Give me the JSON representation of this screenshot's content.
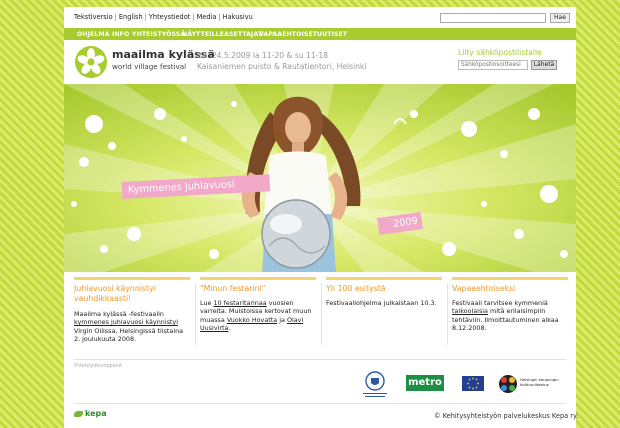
{
  "top_nav": {
    "links": [
      "Tekstiversio",
      "English",
      "Yhteystiedot",
      "Media",
      "Hakusivu"
    ],
    "search_button": "Hae"
  },
  "main_nav": [
    "OHJELMA",
    "INFO",
    "YHTEISTYÖSSÄ",
    "NÄYTTEILLEASETTAJAT",
    "VAPAAEHTOISET",
    "UUTISET"
  ],
  "header": {
    "logo_title": "maailma kylässä",
    "logo_subtitle": "world village festival",
    "dates": "23.-24.5.2009 la 11-20 & su 11-18",
    "place": "Kaisaniemen puisto & Rautatientori, Helsinki",
    "mailing_title": "Liity sähköpostilistalle",
    "mailing_placeholder": "Sähköpostiosoitteesi",
    "mailing_button": "Lähetä"
  },
  "hero": {
    "banner": "Kymmenes juhlavuosi",
    "year": "2009"
  },
  "columns": [
    {
      "title": "Juhlavuosi käynnistyi vauhdikkaasti!",
      "pre": "Maailma kylässä -festivaalin ",
      "link": "kymmenes juhlavuosi käynnistyi",
      "post": " Virgin Oilissa, Helsingissä tiistaina 2. joulukuuta 2008."
    },
    {
      "title": "\"Minun festarini\"",
      "pre": "Lue ",
      "link": "10 festaritarinaa",
      "mid": " vuosien varrelta. Muistoissa kertovat muun muassa ",
      "link2": "Vuokko Hovatta",
      "mid2": " ja ",
      "link3": "Olavi Uusivirta",
      "post": "."
    },
    {
      "title": "Yli 100 esitystä",
      "pre": "Festivaaliohjelma julkaistaan 10.3."
    },
    {
      "title": "Vapaaehtoiseksi",
      "pre": "Festivaali tarvitsee kymmeniä ",
      "link": "talkoolaisia",
      "post": " mitä erilaisimpiin tehtäviin. Ilmoittautuminen alkaa 8.12.2008."
    }
  ],
  "sponsors": {
    "label": "Yhteistyökumppanit",
    "metro": "metro",
    "kulttuuri": "Helsingin kaupungin kulttuurikeskus"
  },
  "footer": {
    "org": "kepa",
    "copyright": "© Kehitysyhteistyön palvelukeskus Kepa ry."
  },
  "colors": {
    "brand_green": "#a8cb2f",
    "accent_orange": "#e99a2c",
    "pink": "#f2a8c8"
  },
  "icons": [
    "flower-logo-icon",
    "leaf-icon"
  ]
}
